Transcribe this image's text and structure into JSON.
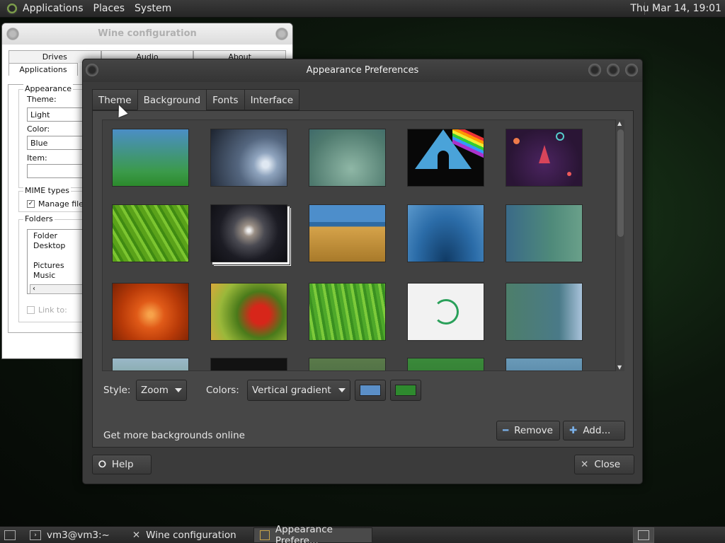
{
  "top_panel": {
    "menus": [
      "Applications",
      "Places",
      "System"
    ],
    "clock": "Thu Mar 14, 19:01"
  },
  "wine": {
    "title": "Wine configuration",
    "tabs_row1": [
      "Drives",
      "Audio",
      "About"
    ],
    "tabs_row2": [
      "Applications"
    ],
    "appearance_label": "Appearance",
    "theme_label": "Theme:",
    "theme_value": "Light",
    "color_label": "Color:",
    "color_value": "Blue",
    "item_label": "Item:",
    "mime_label": "MIME types",
    "manage_file": "Manage file a",
    "folders_label": "Folders",
    "folder_header": "Folder",
    "folders": [
      "Desktop",
      "",
      "Pictures",
      "Music"
    ],
    "link_to": "Link to:"
  },
  "appearance": {
    "title": "Appearance Preferences",
    "tabs": [
      "Theme",
      "Background",
      "Fonts",
      "Interface"
    ],
    "active_tab": "Background",
    "style_label": "Style:",
    "style_value": "Zoom",
    "colors_label": "Colors:",
    "colors_value": "Vertical gradient",
    "primary_color": "#5b8fc7",
    "secondary_color": "#2e8a2e",
    "more_online": "Get more backgrounds online",
    "remove_label": "Remove",
    "add_label": "Add...",
    "help_label": "Help",
    "close_label": "Close"
  },
  "taskbar": {
    "tasks": [
      "vm3@vm3:~",
      "Wine configuration",
      "Appearance Prefere..."
    ]
  }
}
